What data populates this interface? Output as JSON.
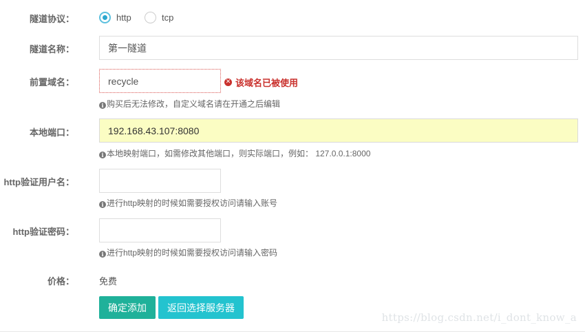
{
  "protocol": {
    "label": "隧道协议：",
    "options": [
      {
        "label": "http",
        "checked": true
      },
      {
        "label": "tcp",
        "checked": false
      }
    ]
  },
  "tunnel_name": {
    "label": "隧道名称：",
    "value": "第一隧道"
  },
  "domain_prefix": {
    "label": "前置域名：",
    "value": "recycle",
    "error": "该域名已被使用",
    "help": "购买后无法修改，自定义域名请在开通之后编辑"
  },
  "local_port": {
    "label": "本地端口：",
    "value": "192.168.43.107:8080",
    "help": "本地映射端口，如需修改其他端口，则实际端口，例如： 127.0.0.1:8000"
  },
  "http_user": {
    "label": "http验证用户名：",
    "value": "",
    "help": "进行http映射的时候如需要授权访问请输入账号"
  },
  "http_password": {
    "label": "http验证密码：",
    "value": "",
    "help": "进行http映射的时候如需要授权访问请输入密码"
  },
  "price": {
    "label": "价格：",
    "value": "免费"
  },
  "actions": {
    "confirm_label": "确定添加",
    "back_label": "返回选择服务器"
  },
  "watermark": "https://blog.csdn.net/i_dont_know_a",
  "colors": {
    "primary_button": "#1fb19a",
    "secondary_button": "#23c3cf",
    "error": "#c9302c",
    "radio_accent": "#2ba7cf",
    "highlight_input": "#fbfdc3"
  },
  "icons": {
    "info": "info-circle-icon",
    "error": "times-circle-icon"
  }
}
